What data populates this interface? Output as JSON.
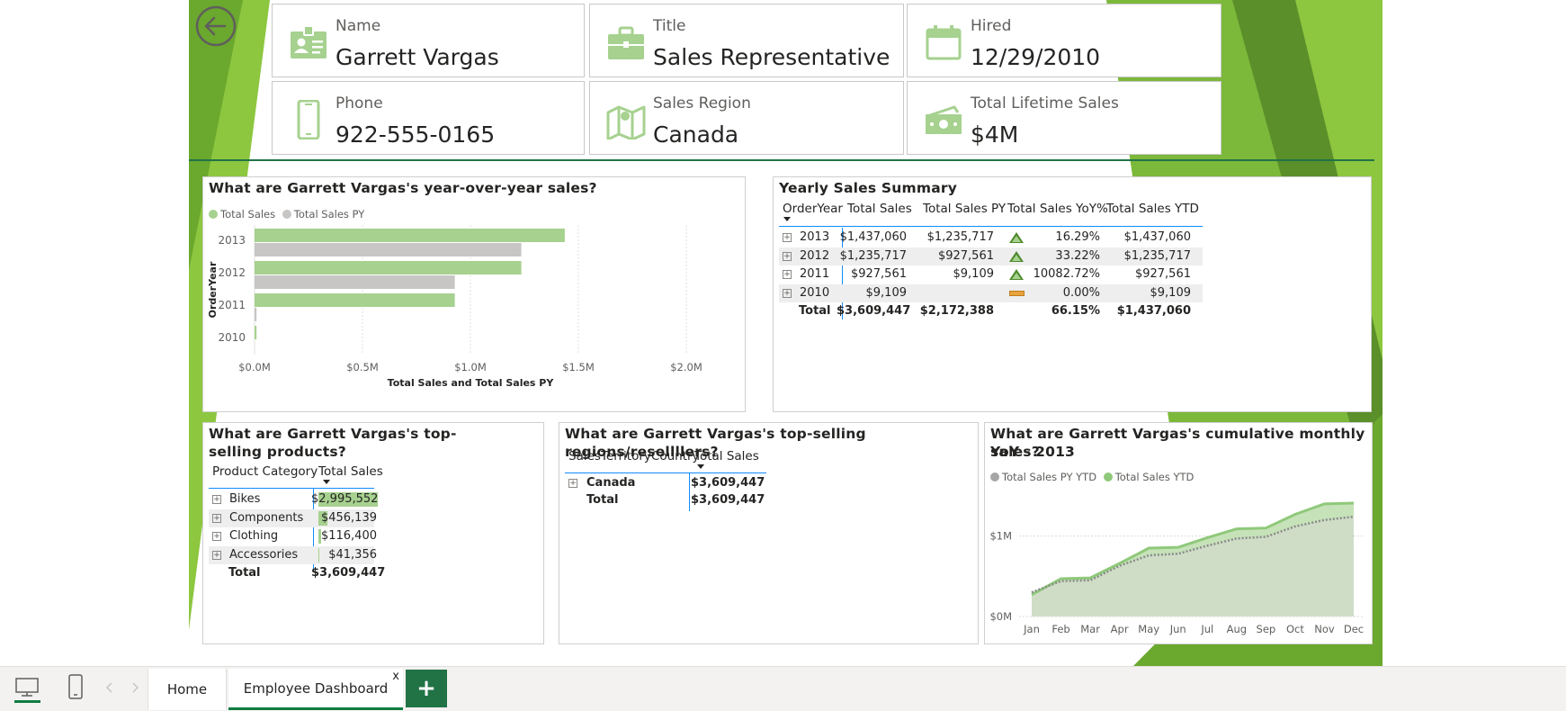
{
  "cards": [
    {
      "label": "Name",
      "value": "Garrett Vargas",
      "icon": "id-card-icon"
    },
    {
      "label": "Title",
      "value": "Sales Representative",
      "icon": "briefcase-icon"
    },
    {
      "label": "Hired",
      "value": "12/29/2010",
      "icon": "calendar-icon"
    },
    {
      "label": "Phone",
      "value": "922-555-0165",
      "icon": "phone-icon"
    },
    {
      "label": "Sales Region",
      "value": "Canada",
      "icon": "map-icon"
    },
    {
      "label": "Total Lifetime Sales",
      "value": "$4M",
      "icon": "money-icon"
    }
  ],
  "yoy": {
    "title": "What are Garrett Vargas's year-over-year sales?",
    "legend": [
      "Total Sales",
      "Total Sales PY"
    ]
  },
  "summary": {
    "title": "Yearly Sales Summary",
    "headers": [
      "OrderYear",
      "Total Sales",
      "Total Sales PY",
      "Total Sales YoY%",
      "Total Sales YTD"
    ],
    "rows": [
      {
        "year": "2013",
        "ts": "$1,437,060",
        "py": "$1,235,717",
        "yoy": "16.29%",
        "ytd": "$1,437,060",
        "ind": "up"
      },
      {
        "year": "2012",
        "ts": "$1,235,717",
        "py": "$927,561",
        "yoy": "33.22%",
        "ytd": "$1,235,717",
        "ind": "up"
      },
      {
        "year": "2011",
        "ts": "$927,561",
        "py": "$9,109",
        "yoy": "10082.72%",
        "ytd": "$927,561",
        "ind": "up"
      },
      {
        "year": "2010",
        "ts": "$9,109",
        "py": "",
        "yoy": "0.00%",
        "ytd": "$9,109",
        "ind": "flat"
      }
    ],
    "total": {
      "label": "Total",
      "ts": "$3,609,447",
      "py": "$2,172,388",
      "yoy": "66.15%",
      "ytd": "$1,437,060"
    }
  },
  "products": {
    "title": "What are Garrett Vargas's top-selling products?",
    "headers": [
      "Product Category",
      "Total Sales"
    ],
    "rows": [
      {
        "cat": "Bikes",
        "val": "$2,995,552",
        "num": 2995552
      },
      {
        "cat": "Components",
        "val": "$456,139",
        "num": 456139
      },
      {
        "cat": "Clothing",
        "val": "$116,400",
        "num": 116400
      },
      {
        "cat": "Accessories",
        "val": "$41,356",
        "num": 41356
      }
    ],
    "total": {
      "label": "Total",
      "val": "$3,609,447"
    }
  },
  "regions": {
    "title": "What are Garrett Vargas's top-selling regions/resellllers?",
    "headers": [
      "SalesTerritoryCountry",
      "Total Sales"
    ],
    "rows": [
      {
        "name": "Canada",
        "val": "$3,609,447"
      }
    ],
    "total": {
      "label": "Total",
      "val": "$3,609,447"
    }
  },
  "cumulative": {
    "title_line1": "What are Garrett Vargas's cumulative monthly sales?",
    "title_line2": "YoY - 2013",
    "legend": [
      "Total Sales PY YTD",
      "Total Sales YTD"
    ]
  },
  "chart_data": [
    {
      "type": "bar",
      "orientation": "horizontal",
      "title": "What are Garrett Vargas's year-over-year sales?",
      "categories": [
        "2013",
        "2012",
        "2011",
        "2010"
      ],
      "series": [
        {
          "name": "Total Sales",
          "values": [
            1437060,
            1235717,
            927561,
            9109
          ]
        },
        {
          "name": "Total Sales PY",
          "values": [
            1235717,
            927561,
            9109,
            0
          ]
        }
      ],
      "xlabel": "Total Sales and Total Sales PY",
      "ylabel": "OrderYear",
      "xlim": [
        0,
        2000000
      ],
      "xticks": [
        "$0.0M",
        "$0.5M",
        "$1.0M",
        "$1.5M",
        "$2.0M"
      ],
      "grid": true,
      "legend": "top-left",
      "colors": [
        "#a6d18f",
        "#c8c6c4"
      ]
    },
    {
      "type": "area",
      "title": "What are Garrett Vargas's cumulative monthly sales? YoY - 2013",
      "categories": [
        "Jan",
        "Feb",
        "Mar",
        "Apr",
        "May",
        "Jun",
        "Jul",
        "Aug",
        "Sep",
        "Oct",
        "Nov",
        "Dec"
      ],
      "series": [
        {
          "name": "Total Sales PY YTD",
          "values": [
            0.3,
            0.44,
            0.45,
            0.63,
            0.76,
            0.78,
            0.88,
            0.97,
            0.99,
            1.12,
            1.2,
            1.24
          ]
        },
        {
          "name": "Total Sales YTD",
          "values": [
            0.27,
            0.47,
            0.48,
            0.66,
            0.85,
            0.86,
            0.98,
            1.09,
            1.1,
            1.27,
            1.4,
            1.41
          ]
        }
      ],
      "unit": "millions",
      "ylim": [
        0,
        1.6
      ],
      "yticks": [
        "$0M",
        "$1M"
      ],
      "grid": true,
      "legend": "top-left",
      "colors": [
        "#a6a6a6",
        "#8fc97a"
      ]
    }
  ],
  "taskbar": {
    "tabs": [
      "Home",
      "Employee Dashboard"
    ],
    "close": "x",
    "add": "+"
  },
  "colors": {
    "accent": "#a6d18f",
    "brand": "#107c41",
    "green_dark": "#4f8a2b",
    "orange": "#e8a33d"
  }
}
